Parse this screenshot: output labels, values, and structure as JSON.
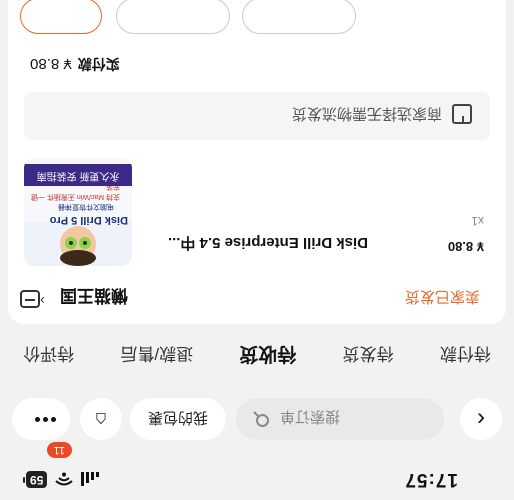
{
  "status_bar": {
    "time": "17:57",
    "battery": "59"
  },
  "search": {
    "placeholder": "搜索订单",
    "gift_label": "我的包裹",
    "hanger_icon": "hanger-icon",
    "badge": "11"
  },
  "tabs": [
    "待付款",
    "待发货",
    "待收货",
    "退款/售后",
    "待评价"
  ],
  "order": {
    "shop_name": "懒猫王国",
    "status": "卖家已发货",
    "product": {
      "title": "Disk Drill Enterprise 5.4 中...",
      "price": "¥ 8.80",
      "qty": "x1",
      "image": {
        "title": "Disk Drill 5 Pro",
        "sub1": "电脑文件恢复神器",
        "sub2": "支持 Mac/Win 无需插件 一键安装",
        "banner": "永久更新 安装指南"
      }
    },
    "notice": "商家选择无需物流发货",
    "paid_label": "实付款",
    "paid_amount": "¥ 8.80"
  },
  "colors": {
    "accent": "#e8672a",
    "badge": "#e74a25",
    "banner": "#3d2a86"
  }
}
